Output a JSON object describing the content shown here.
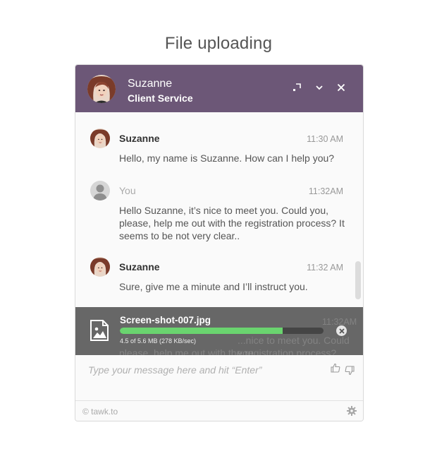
{
  "page": {
    "title": "File uploading"
  },
  "header": {
    "agent_name": "Suzanne",
    "agent_role": "Client Service"
  },
  "messages": [
    {
      "sender": "Suzanne",
      "time": "11:30 AM",
      "text": "Hello, my name is Suzanne. How can I help you?"
    },
    {
      "sender": "You",
      "time": "11:32AM",
      "text": "Hello Suzanne, it’s nice to meet you. Could you, please, help me out with the registration process? It seems to be not very clear.."
    },
    {
      "sender": "Suzanne",
      "time": "11:32 AM",
      "text": "Sure, give me a minute and I’ll instruct you."
    }
  ],
  "upload": {
    "file_name": "Screen-shot-007.jpg",
    "progress": 0.8,
    "size_text": "4.5 of 5.6 MB (278 KB/sec)",
    "ghost_time": "11:32AM",
    "ghost_line1": "...nice to meet you. Could you,",
    "ghost_line2": "please, help me out with the registration process?"
  },
  "composer": {
    "placeholder": "Type your message here and hit “Enter”"
  },
  "footer": {
    "brand": "© tawk.to"
  },
  "colors": {
    "header": "#6c5777",
    "progress": "#6ad46f",
    "overlay": "#5a5a5a"
  },
  "icons": [
    "maximize-icon",
    "chevron-down-icon",
    "close-icon",
    "image-file-icon",
    "cancel-upload-icon",
    "thumbs-up-icon",
    "thumbs-down-icon",
    "gear-icon"
  ]
}
